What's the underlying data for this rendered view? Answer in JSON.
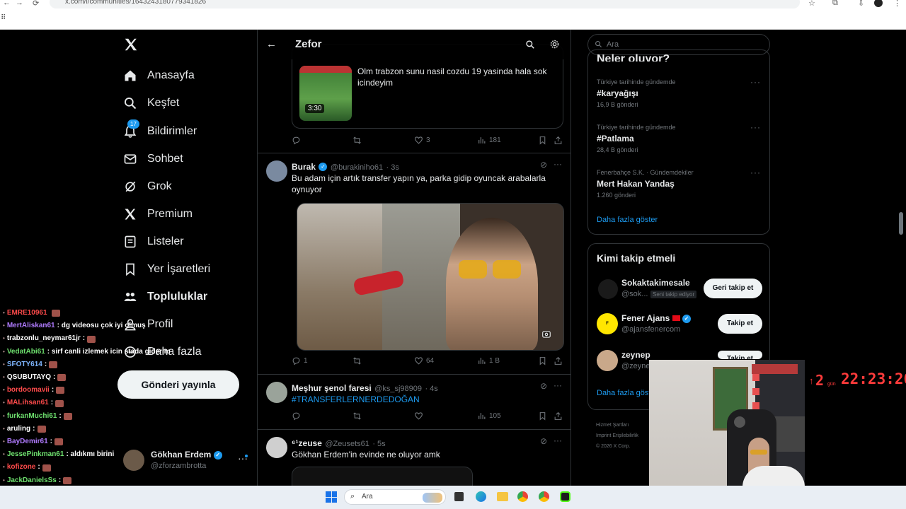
{
  "browser": {
    "url": "x.com/i/communities/1643243180779341826"
  },
  "nav": {
    "items": [
      {
        "label": "Anasayfa",
        "icon": "home-icon"
      },
      {
        "label": "Keşfet",
        "icon": "search-icon"
      },
      {
        "label": "Bildirimler",
        "icon": "bell-icon",
        "badge": "17"
      },
      {
        "label": "Sohbet",
        "icon": "mail-icon"
      },
      {
        "label": "Grok",
        "icon": "grok-icon"
      },
      {
        "label": "Premium",
        "icon": "x-logo-icon"
      },
      {
        "label": "Listeler",
        "icon": "list-icon"
      },
      {
        "label": "Yer İşaretleri",
        "icon": "bookmark-icon"
      },
      {
        "label": "Topluluklar",
        "icon": "communities-icon"
      },
      {
        "label": "Profil",
        "icon": "person-icon"
      },
      {
        "label": "Daha fazla",
        "icon": "more-circle-icon"
      }
    ],
    "post_button": "Gönderi yayınla"
  },
  "profile": {
    "name": "Gökhan Erdem",
    "handle": "@zforzambrotta"
  },
  "chat": [
    {
      "user": "EMRE10961",
      "msg": "",
      "color": "#ff4b4b"
    },
    {
      "user": "MertAliskan61",
      "msg": ": dg videosu çok iyi olmuş",
      "color": "#b07bff"
    },
    {
      "user": "trabzonlu_neymar61jr",
      "msg": ":",
      "color": "#ffffff"
    },
    {
      "user": "VedatAbi61",
      "msg": ": sirf canli izlemek icin stada giderim",
      "color": "#6ee06e"
    },
    {
      "user": "SFOTY614",
      "msg": ":",
      "color": "#7fb6ff"
    },
    {
      "user": "QSUBUTAYQ",
      "msg": ":",
      "color": "#ffffff"
    },
    {
      "user": "bordoomavii",
      "msg": ":",
      "color": "#ff4b4b"
    },
    {
      "user": "MALihsan61",
      "msg": ":",
      "color": "#ff4b4b"
    },
    {
      "user": "furkanMuchi61",
      "msg": ":",
      "color": "#6ee06e"
    },
    {
      "user": "aruling",
      "msg": ":",
      "color": "#ffffff"
    },
    {
      "user": "BayDemir61",
      "msg": ":",
      "color": "#b07bff"
    },
    {
      "user": "JessePinkman61",
      "msg": ": aldıkmı birini",
      "color": "#6ee06e"
    },
    {
      "user": "kofizone",
      "msg": ":",
      "color": "#ff4b4b"
    },
    {
      "user": "JackDanielsSs",
      "msg": ":",
      "color": "#6ee06e"
    }
  ],
  "community": {
    "title": "Zefor"
  },
  "tweets": [
    {
      "text": "Olm trabzon sunu nasil cozdu 19 yasinda hala sok icindeyim",
      "video_duration": "3:30",
      "replies": "",
      "retweets": "",
      "likes": "3",
      "views": "181"
    },
    {
      "name": "Burak",
      "handle": "@burakiniho61",
      "time": "· 3s",
      "text": "Bu adam için artık transfer yapın ya, parka gidip oyuncak arabalarla oynuyor",
      "replies": "1",
      "retweets": "",
      "likes": "64",
      "views": "1 B"
    },
    {
      "name": "Meşhur şenol faresi",
      "handle": "@ks_sj98909",
      "time": "· 4s",
      "text": "#TRANSFERLERNERDEDOĞAN",
      "replies": "",
      "retweets": "",
      "likes": "",
      "views": "105"
    },
    {
      "name": "⁶¹zeuse",
      "handle": "@Zeusets61",
      "time": "· 5s",
      "text": "Gökhan Erdem'in evinde ne oluyor amk"
    }
  ],
  "right": {
    "search_placeholder": "Ara",
    "trends_title": "Neler oluyor?",
    "trends": [
      {
        "context": "Türkiye tarihinde gündemde",
        "name": "#karyağışı",
        "count": "16,9 B gönderi"
      },
      {
        "context": "Türkiye tarihinde gündemde",
        "name": "#Patlama",
        "count": "28,4 B gönderi"
      },
      {
        "context": "Fenerbahçe S.K. · Gündemdekiler",
        "name": "Mert Hakan Yandaş",
        "count": "1.260 gönderi"
      }
    ],
    "show_more": "Daha fazla göster",
    "who_to_follow_title": "Kimi takip etmeli",
    "suggestions": [
      {
        "name": "Sokaktakimesale",
        "handle": "@sok...",
        "note": "Seni takip ediyor",
        "button": "Geri takip et"
      },
      {
        "name": "Fener Ajans",
        "handle": "@ajansfenercom",
        "button": "Takip et"
      },
      {
        "name": "zeynep",
        "handle": "@zeynep",
        "button": "Takip et"
      }
    ],
    "show_more2": "Daha fazla göster",
    "footer": [
      "Hizmet Şartları",
      "Imprint",
      "Erişilebilirlik",
      "© 2026 X Corp."
    ]
  },
  "taskbar": {
    "search": "Ara"
  },
  "stream": {
    "clock": "22:23:26",
    "days": "2",
    "days_label": "gün"
  },
  "colors": {
    "accent": "#1d9bf0",
    "background": "#000000",
    "border": "#2f3336",
    "muted": "#71767b"
  }
}
